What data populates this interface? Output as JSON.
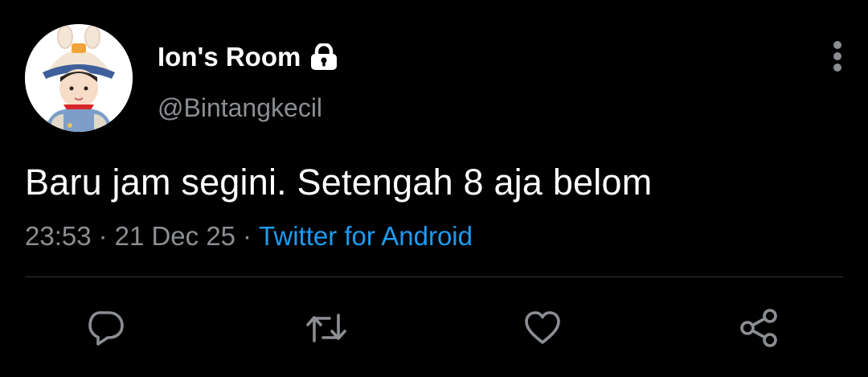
{
  "tweet": {
    "display_name": "Ion's Room",
    "handle": "@Bintangkecil",
    "text": "Baru jam segini. Setengah 8 aja belom",
    "time": "23:53",
    "separator": "·",
    "date": "21 Dec 25",
    "source": "Twitter for Android",
    "protected": true
  },
  "icons": {
    "avatar": "profile-photo",
    "lock": "lock-icon",
    "more": "more-vertical-icon",
    "reply": "reply-icon",
    "retweet": "retweet-icon",
    "like": "heart-icon",
    "share": "share-icon"
  },
  "colors": {
    "background": "#000000",
    "text": "#ffffff",
    "secondary_text": "#8b8e92",
    "link": "#1d9bf0",
    "divider": "#2f3336",
    "icon": "#8b8e92"
  }
}
